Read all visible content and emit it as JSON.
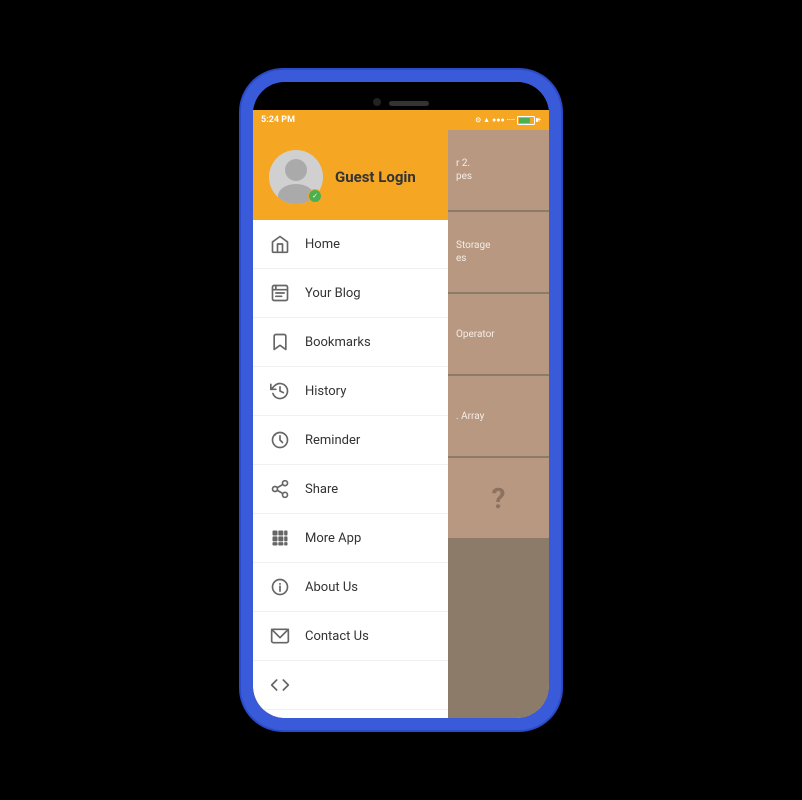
{
  "status_bar": {
    "time": "5:24 PM",
    "icons_text": "⊙ ▲ ●●●  ····",
    "battery_label": "battery"
  },
  "drawer_header": {
    "guest_login": "Guest Login"
  },
  "menu_items": [
    {
      "id": "home",
      "label": "Home",
      "icon": "home"
    },
    {
      "id": "your-blog",
      "label": "Your Blog",
      "icon": "blog"
    },
    {
      "id": "bookmarks",
      "label": "Bookmarks",
      "icon": "bookmark"
    },
    {
      "id": "history",
      "label": "History",
      "icon": "history"
    },
    {
      "id": "reminder",
      "label": "Reminder",
      "icon": "reminder"
    },
    {
      "id": "share",
      "label": "Share",
      "icon": "share"
    },
    {
      "id": "more-app",
      "label": "More App",
      "icon": "grid"
    },
    {
      "id": "about-us",
      "label": "About Us",
      "icon": "info"
    },
    {
      "id": "contact-us",
      "label": "Contact Us",
      "icon": "mail"
    },
    {
      "id": "code",
      "label": "",
      "icon": "code"
    }
  ],
  "bg_cards": [
    {
      "text": "r 2.\npes"
    },
    {
      "text": "Storage\nes"
    },
    {
      "text": "Operator"
    },
    {
      "text": ". Array"
    }
  ]
}
